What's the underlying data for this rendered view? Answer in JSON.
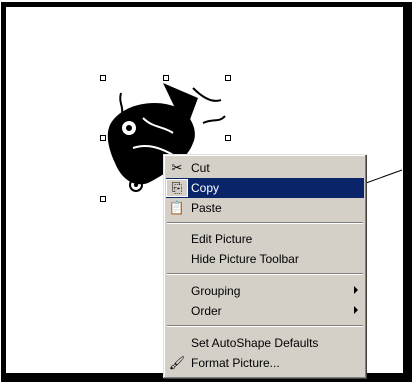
{
  "context_menu": {
    "items": [
      {
        "label": "Cut",
        "icon": "scissors-icon"
      },
      {
        "label": "Copy",
        "icon": "copy-icon",
        "selected": true
      },
      {
        "label": "Paste",
        "icon": "paste-icon"
      },
      {
        "label": "Edit Picture"
      },
      {
        "label": "Hide Picture Toolbar"
      },
      {
        "label": "Grouping",
        "submenu": true
      },
      {
        "label": "Order",
        "submenu": true
      },
      {
        "label": "Set AutoShape Defaults"
      },
      {
        "label": "Format Picture...",
        "icon": "format-picture-icon"
      }
    ]
  },
  "colors": {
    "menu_bg": "#d4d0c8",
    "highlight": "#0a246a"
  }
}
